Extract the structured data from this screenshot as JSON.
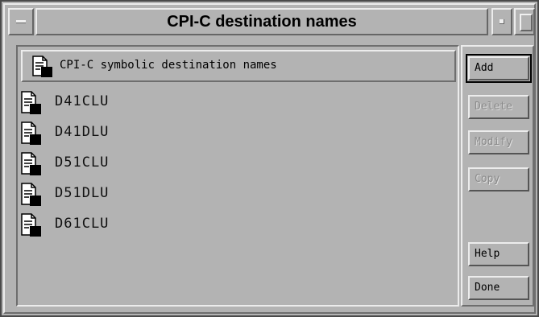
{
  "window": {
    "title": "CPI-C destination names"
  },
  "list": {
    "header": "CPI-C symbolic destination names",
    "items": [
      {
        "label": "D41CLU"
      },
      {
        "label": "D41DLU"
      },
      {
        "label": "D51CLU"
      },
      {
        "label": "D51DLU"
      },
      {
        "label": "D61CLU"
      }
    ]
  },
  "buttons": {
    "add": "Add",
    "delete": "Delete",
    "modify": "Modify",
    "copy": "Copy",
    "help": "Help",
    "done": "Done"
  },
  "icons": {
    "window_menu": "window-menu-icon",
    "minimize": "minimize-icon",
    "maximize": "maximize-icon",
    "entry": "document-icon"
  }
}
